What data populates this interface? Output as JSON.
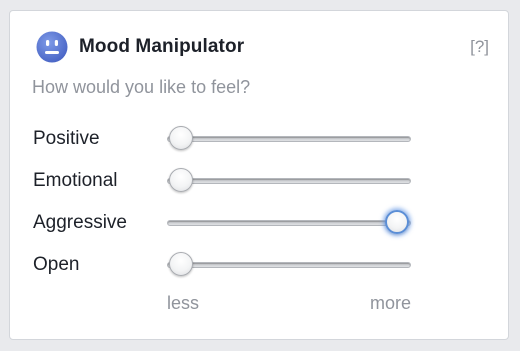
{
  "widget": {
    "title": "Mood Manipulator",
    "help_label": "[?]",
    "subtitle": "How would you like to feel?",
    "icon": "smiley-face-icon",
    "accent_color": "#5b7bd5"
  },
  "sliders": [
    {
      "label": "Positive",
      "level": 0.0,
      "focused": false
    },
    {
      "label": "Emotional",
      "level": 0.0,
      "focused": false
    },
    {
      "label": "Aggressive",
      "level": 1.0,
      "focused": true
    },
    {
      "label": "Open",
      "level": 0.0,
      "focused": false
    }
  ],
  "scale": {
    "less_label": "less",
    "more_label": "more"
  }
}
